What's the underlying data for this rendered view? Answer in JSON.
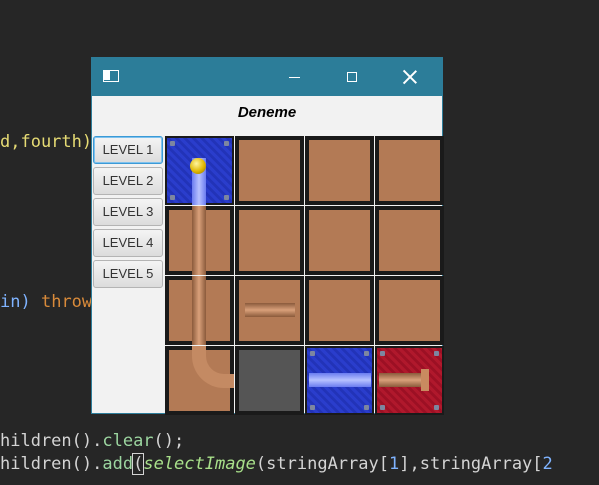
{
  "editor": {
    "line1": "d,fourth)",
    "line2_in": "in)",
    "line2_throw": "throw",
    "line3_prefix": "hildren().",
    "line3_method": "clear",
    "line3_suffix": "();",
    "line4_prefix": "hildren().",
    "line4_method": "add",
    "line4_paren": "(",
    "line4_call": "selectImage",
    "line4_args1": "(stringArray[",
    "line4_num1": "1",
    "line4_args2": "],stringArray[",
    "line4_num2": "2"
  },
  "window": {
    "title": "Deneme",
    "levels": [
      "LEVEL 1",
      "LEVEL 2",
      "LEVEL 3",
      "LEVEL 4",
      "LEVEL 5"
    ]
  },
  "board": {
    "tiles": [
      {
        "kind": "start-ball",
        "color": "blue"
      },
      {
        "kind": "empty",
        "color": "brown"
      },
      {
        "kind": "empty",
        "color": "brown"
      },
      {
        "kind": "empty",
        "color": "brown"
      },
      {
        "kind": "pipe-vertical",
        "color": "brown"
      },
      {
        "kind": "empty",
        "color": "brown"
      },
      {
        "kind": "empty",
        "color": "brown"
      },
      {
        "kind": "empty",
        "color": "brown"
      },
      {
        "kind": "pipe-vertical",
        "color": "brown"
      },
      {
        "kind": "pipe-horizontal",
        "color": "brown"
      },
      {
        "kind": "empty",
        "color": "brown"
      },
      {
        "kind": "empty",
        "color": "brown"
      },
      {
        "kind": "pipe-curve",
        "color": "brown"
      },
      {
        "kind": "blank",
        "color": "gray"
      },
      {
        "kind": "pipe-horizontal",
        "color": "blue"
      },
      {
        "kind": "end",
        "color": "red"
      }
    ]
  }
}
